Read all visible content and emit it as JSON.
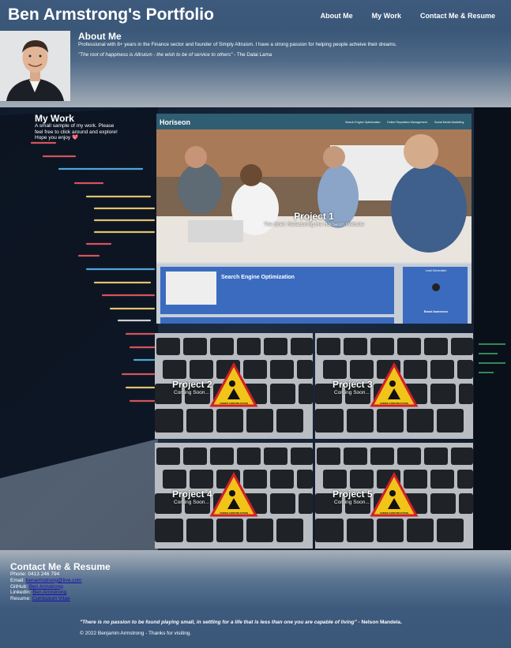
{
  "header": {
    "title": "Ben Armstrong's Portfolio",
    "nav": [
      "About Me",
      "My Work",
      "Contact Me & Resume"
    ]
  },
  "about": {
    "title": "About Me",
    "text": "Professional with 8+ years in the Finance sector and founder of Simply Altruism. I have a strong passion for helping people acheive their dreams.",
    "quote": "\"The root of happiness is Altruism - the wish to be of service to others\"",
    "quote_author": " - The Dalai Lama"
  },
  "work": {
    "title": "My Work",
    "desc": "A small sample of my work. Please feel free to click around and explore! Hope you enjoy 💖",
    "projects": [
      {
        "name": "Project 1",
        "sub": "The Brief: Refactoring the Horiseon Website"
      },
      {
        "name": "Project 2",
        "sub": "Coming Soon..."
      },
      {
        "name": "Project 3",
        "sub": "Coming Soon..."
      },
      {
        "name": "Project 4",
        "sub": "Coming Soon..."
      },
      {
        "name": "Project 5",
        "sub": "Coming Soon..."
      }
    ],
    "horiseon": {
      "brand": "Horiseon",
      "nav": [
        "Search Engine Optimization",
        "Online Reputation Management",
        "Social Media Marketing"
      ],
      "seo_title": "Search Engine Optimization",
      "lead_title": "Lead Generation",
      "brand_title": "Brand Awareness"
    },
    "warning_sign": "UNDER CONSTRUCTION"
  },
  "contact": {
    "title": "Contact Me & Resume",
    "phone_label": "Phone: ",
    "phone": "0413 246 794",
    "email_label": "Email: ",
    "email": "benarmstrong@live.com",
    "github_label": "GitHub: ",
    "github": "Ben Armstrong",
    "linkedin_label": "LinkedIn: ",
    "linkedin": "Ben Armstrong",
    "resume_label": "Resume: ",
    "resume": "Curriculum Vitae",
    "quote": "\"There is no passion to be found playing small, in settling for a life that is less than one you are capable of living\"",
    "quote_author": " - Nelson Mandela.",
    "copyright": "© 2022 Benjamin Armstrong - Thanks for visiting."
  },
  "colors": {
    "header_bg": "#3d5a7d",
    "link": "#1a0dab",
    "horiseon_blue": "#3b6bbf"
  }
}
